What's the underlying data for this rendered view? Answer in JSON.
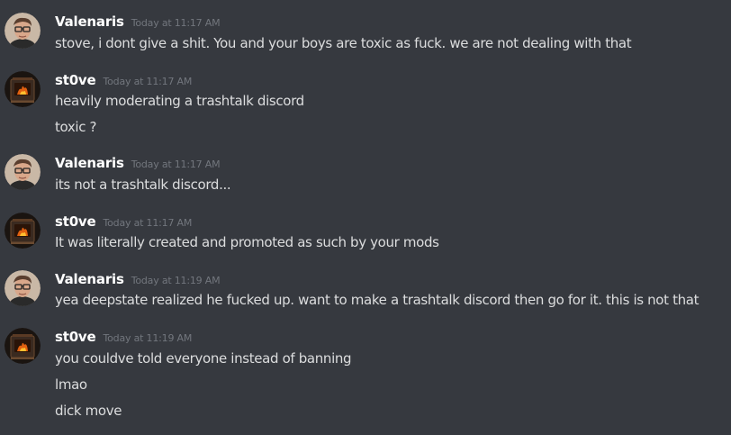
{
  "messages": [
    {
      "author": "Valenaris",
      "timestamp": "Today at 11:17 AM",
      "lines": [
        "stove, i dont give a shit. You and your boys are toxic as fuck. we are not dealing with that"
      ]
    },
    {
      "author": "st0ve",
      "timestamp": "Today at 11:17 AM",
      "lines": [
        "heavily moderating a trashtalk discord",
        "toxic ?"
      ]
    },
    {
      "author": "Valenaris",
      "timestamp": "Today at 11:17 AM",
      "lines": [
        "its not a trashtalk discord..."
      ]
    },
    {
      "author": "st0ve",
      "timestamp": "Today at 11:17 AM",
      "lines": [
        "It was literally created and promoted as such by your mods"
      ]
    },
    {
      "author": "Valenaris",
      "timestamp": "Today at 11:19 AM",
      "lines": [
        "yea deepstate realized he fucked up. want to make a trashtalk discord then go for it. this is not that"
      ]
    },
    {
      "author": "st0ve",
      "timestamp": "Today at 11:19 AM",
      "lines": [
        "you couldve told everyone instead of banning",
        "lmao",
        "dick move"
      ]
    }
  ],
  "colors": {
    "background": "#36393f",
    "username": "#ffffff",
    "timestamp": "#72767d",
    "message_text": "#dcddde"
  },
  "icons": {
    "valenaris_avatar": "person-with-glasses-avatar",
    "stove_avatar": "fireplace-stove-avatar"
  }
}
